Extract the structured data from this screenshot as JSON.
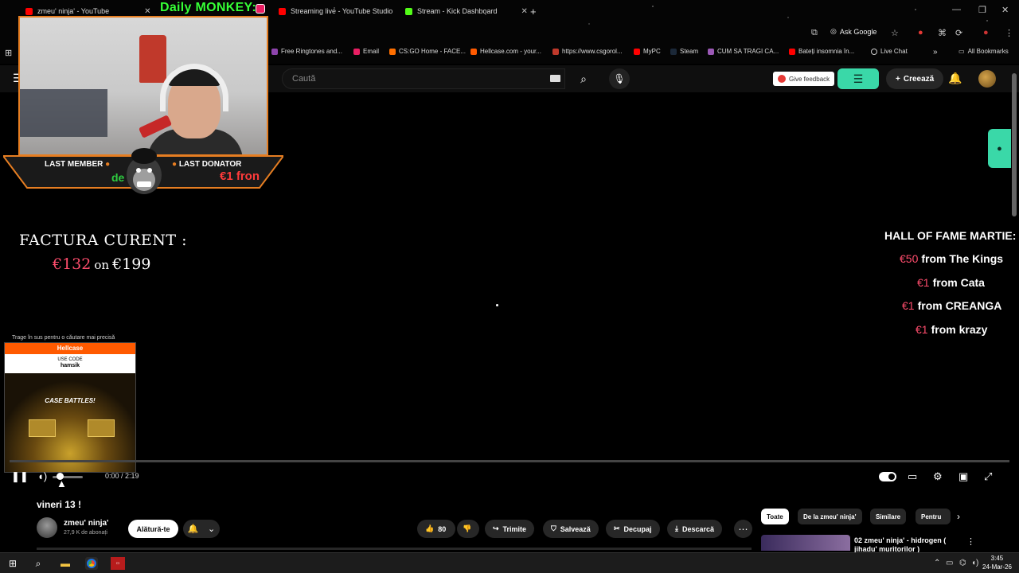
{
  "tabs": [
    {
      "title": "zmeu' ninja' - YouTube",
      "fav_color": "#ff0000"
    },
    {
      "title": "Streaming live - YouTube Studio",
      "fav_color": "#ff0000"
    },
    {
      "title": "Stream - Kick Dashboard",
      "fav_color": "#53fc18"
    }
  ],
  "overlay_title": "Daily MONKEY:",
  "ask_google": "Ask Google",
  "bookmarks": [
    "Free Ringtones and...",
    "Email",
    "CS:GO Home - FACE...",
    "Hellcase.com - your...",
    "https://www.csgorol...",
    "MyPC",
    "Steam",
    "CUM SA TRAGI CA...",
    "Bateți insomnia în...",
    "Live Chat",
    "All Bookmarks"
  ],
  "search_placeholder": "Caută",
  "give_feedback": "Give feedback",
  "create_label": "Creează",
  "last_member": {
    "label": "LAST MEMBER",
    "value": "de"
  },
  "last_donator": {
    "label": "LAST DONATOR",
    "value": "€1 fron"
  },
  "factura": {
    "title": "FACTURA CURENT :",
    "current": "€132",
    "on": "on",
    "target": "€199"
  },
  "hall_of_fame": {
    "title": "HALL OF FAME MARTIE:",
    "entries": [
      {
        "amount": "€50",
        "text": "from The Kings"
      },
      {
        "amount": "€1",
        "text": "from Cata"
      },
      {
        "amount": "€1",
        "text": "from CREANGA"
      },
      {
        "amount": "€1",
        "text": "from krazy"
      }
    ]
  },
  "ad": {
    "tip": "Trage în sus pentru o căutare mai precisă",
    "brand": "Hellcase",
    "use_code": "USE CODE",
    "code": "hamsik",
    "headline": "CASE BATTLES!"
  },
  "player": {
    "time": "0:00 / 2:19"
  },
  "video": {
    "title": "vineri 13 !",
    "channel": "zmeu' ninja'",
    "subscribers": "27,9 K de abonați",
    "join_label": "Alătură-te",
    "likes": "80",
    "share_label": "Trimite",
    "save_label": "Salvează",
    "clip_label": "Decupaj",
    "download_label": "Descarcă"
  },
  "chips": [
    "Toate",
    "De la zmeu' ninja'",
    "Similare",
    "Pentru"
  ],
  "recommended": {
    "title": "02 zmeu' ninja' - hidrogen ( jihadu' muritorilor )"
  },
  "clock": {
    "time": "3:45",
    "date": "24-Mar-26"
  },
  "colors": {
    "accent_green": "#3ad8a8",
    "overlay_green": "#36ff36",
    "donation_red": "#ff4d6d",
    "cam_border": "#e67e22"
  }
}
